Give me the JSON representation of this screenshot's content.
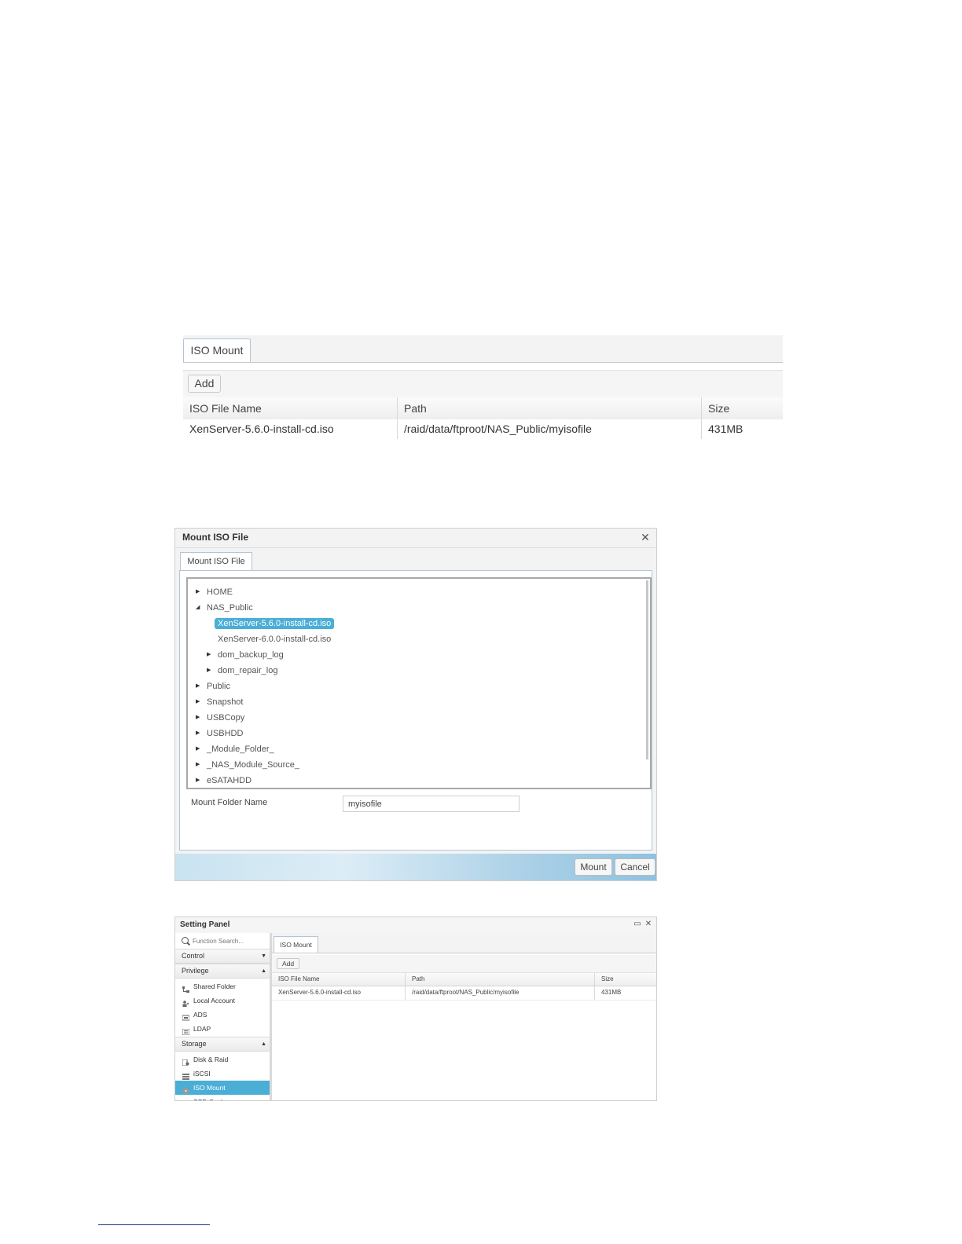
{
  "iso_mount_list": {
    "tab_label": "ISO Mount",
    "add_label": "Add",
    "columns": [
      "ISO File Name",
      "Path",
      "Size"
    ],
    "rows": [
      [
        "XenServer-5.6.0-install-cd.iso",
        "/raid/data/ftproot/NAS_Public/myisofile",
        "431MB"
      ]
    ]
  },
  "mount_dialog": {
    "title": "Mount ISO File",
    "tab_label": "Mount ISO File",
    "tree": [
      {
        "label": "HOME",
        "level": 0,
        "arrow": "collapsed"
      },
      {
        "label": "NAS_Public",
        "level": 0,
        "arrow": "expanded"
      },
      {
        "label": "XenServer-5.6.0-install-cd.iso",
        "level": 1,
        "arrow": "none",
        "selected": true
      },
      {
        "label": "XenServer-6.0.0-install-cd.iso",
        "level": 1,
        "arrow": "none"
      },
      {
        "label": "dom_backup_log",
        "level": 1,
        "arrow": "collapsed"
      },
      {
        "label": "dom_repair_log",
        "level": 1,
        "arrow": "collapsed"
      },
      {
        "label": "Public",
        "level": 0,
        "arrow": "collapsed"
      },
      {
        "label": "Snapshot",
        "level": 0,
        "arrow": "collapsed"
      },
      {
        "label": "USBCopy",
        "level": 0,
        "arrow": "collapsed"
      },
      {
        "label": "USBHDD",
        "level": 0,
        "arrow": "collapsed"
      },
      {
        "label": "_Module_Folder_",
        "level": 0,
        "arrow": "collapsed"
      },
      {
        "label": "_NAS_Module_Source_",
        "level": 0,
        "arrow": "collapsed"
      },
      {
        "label": "eSATAHDD",
        "level": 0,
        "arrow": "collapsed"
      }
    ],
    "field_label": "Mount Folder Name",
    "field_value": "myisofile",
    "mount_label": "Mount",
    "cancel_label": "Cancel"
  },
  "setting_panel": {
    "title": "Setting Panel",
    "search_placeholder": "Function Search...",
    "groups": [
      {
        "label": "Control",
        "caret": "▼",
        "items": []
      },
      {
        "label": "Privilege",
        "caret": "▲",
        "items": [
          {
            "label": "Shared Folder",
            "icon": "shared-folder-icon"
          },
          {
            "label": "Local Account",
            "icon": "local-account-icon"
          },
          {
            "label": "ADS",
            "icon": "ads-icon"
          },
          {
            "label": "LDAP",
            "icon": "ldap-icon"
          }
        ]
      },
      {
        "label": "Storage",
        "caret": "▲",
        "items": [
          {
            "label": "Disk & Raid",
            "icon": "disk-raid-icon"
          },
          {
            "label": "iSCSI",
            "icon": "iscsi-icon"
          },
          {
            "label": "ISO Mount",
            "icon": "iso-mount-icon",
            "active": true
          },
          {
            "label": "SSD Cache",
            "icon": "ssd-cache-icon"
          }
        ]
      }
    ],
    "tab_label": "ISO Mount",
    "add_label": "Add",
    "columns": [
      "ISO File Name",
      "Path",
      "Size"
    ],
    "rows": [
      [
        "XenServer-5.6.0-install-cd.iso",
        "/raid/data/ftproot/NAS_Public/myisofile",
        "431MB"
      ]
    ],
    "colors": {
      "active": "#4aaed6"
    }
  }
}
